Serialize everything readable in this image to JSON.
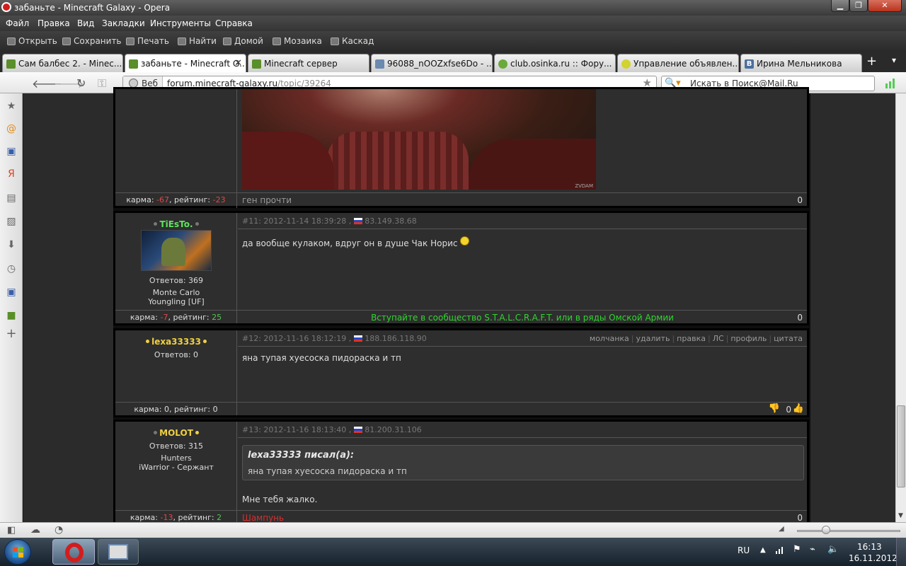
{
  "window": {
    "title": "забаньте - Minecraft Galaxy - Opera"
  },
  "menu": [
    "Файл",
    "Правка",
    "Вид",
    "Закладки",
    "Инструменты",
    "Справка"
  ],
  "toolbar": [
    "Открыть",
    "Сохранить",
    "Печать",
    "Найти",
    "Домой",
    "Мозаика",
    "Каскад"
  ],
  "tabs": [
    {
      "label": "Сам балбес 2. - Minec..."
    },
    {
      "label": "забаньте - Minecraft G..."
    },
    {
      "label": "Minecraft сервер"
    },
    {
      "label": "96088_nOOZxfse6Do - ..."
    },
    {
      "label": "club.osinka.ru :: Фору..."
    },
    {
      "label": "Управление объявлен..."
    },
    {
      "label": "Ирина Мельникова"
    }
  ],
  "address": {
    "web_label": "Веб",
    "domain": "forum.minecraft-galaxy.ru",
    "path": "/topic/39264"
  },
  "search": {
    "placeholder": "Искать в Поиск@Mail.Ru"
  },
  "posts": [
    {
      "footer_karma_label": "карма: ",
      "karma": "-67",
      "rating_label": ", рейтинг: ",
      "rating": "-23",
      "signature": "ген прочти",
      "count": "0",
      "image_caption": "ZVDAM"
    },
    {
      "username": "TiEsTo.",
      "replies": "Ответов: 369",
      "info1": "Monte Carlo",
      "info2": "Youngling [UF]",
      "num": "#11",
      "date": "2012-11-14 18:39:28",
      "ip": "83.149.38.68",
      "text": "да вообще кулаком, вдруг он в душе Чак Норис",
      "karma_label": "карма: ",
      "karma": "-7",
      "rating_label": ", рейтинг: ",
      "rating": "25",
      "signature": "Вступайте в сообщество S.T.A.L.C.R.A.F.T. или в ряды Омской Армии",
      "count": "0"
    },
    {
      "username": "lexa33333",
      "replies": "Ответов: 0",
      "num": "#12",
      "date": "2012-11-16 18:12:19",
      "ip": "188.186.118.90",
      "actions": [
        "молчанка",
        "удалить",
        "правка",
        "ЛС",
        "профиль",
        "цитата"
      ],
      "text": "яна тупая хуесоска пидораска и тп",
      "footer": "карма: 0, рейтинг: 0",
      "count": "0"
    },
    {
      "username": "MOLOT",
      "replies": "Ответов: 315",
      "info1": "Hunters",
      "info2": "iWarrior - Сержант",
      "num": "#13",
      "date": "2012-11-16 18:13:40",
      "ip": "81.200.31.106",
      "quote_author": "lexa33333 писал(а):",
      "quote_text": "яна тупая хуесоска пидораска и тп",
      "text": "Мне тебя жалко.",
      "karma_label": "карма: ",
      "karma": "-13",
      "rating_label": ", рейтинг: ",
      "rating": "2",
      "signature": "Шампунь",
      "count": "0"
    }
  ],
  "taskbar": {
    "lang": "RU",
    "time": "16:13",
    "date": "16.11.2012"
  }
}
